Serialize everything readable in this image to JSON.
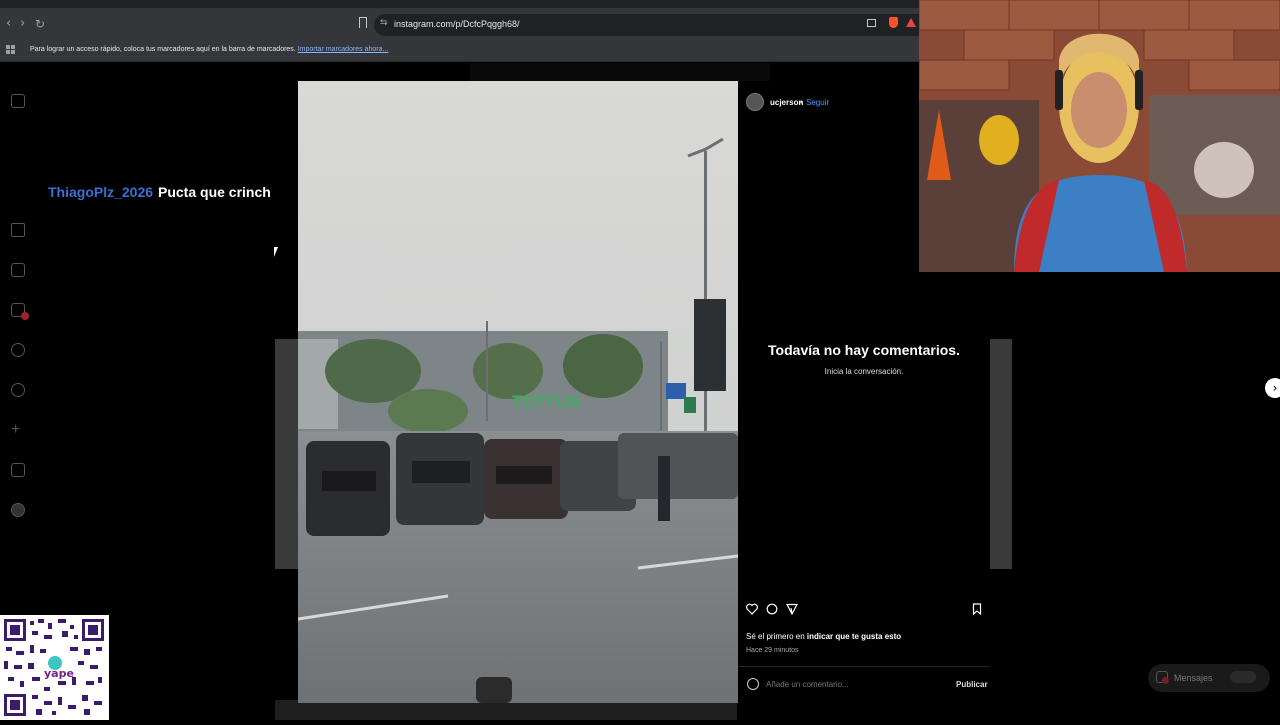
{
  "browser": {
    "url": "instagram.com/p/DcfcPqggh68/",
    "bookmarks_bar_text": "Para lograr un acceso rápido, coloca tus marcadores aquí en la barra de marcadores.",
    "bookmarks_bar_link": "Importar marcadores ahora...",
    "back_glyph": "‹",
    "forward_glyph": "›",
    "reload_glyph": "↻",
    "site_icon_glyph": "⇆"
  },
  "stream_overlay": {
    "chat_user": "ThiagoPlz_2026",
    "chat_message": "Pucta que crinch",
    "user_color": "#3b6fd4"
  },
  "sidebar": {
    "icons": [
      "instagram-logo-icon",
      "home-icon",
      "reels-icon",
      "messages-icon",
      "search-icon",
      "notifications-icon",
      "create-icon",
      "dashboard-icon",
      "profile-icon"
    ]
  },
  "post": {
    "username": "ucjerson",
    "separator": "•",
    "follow_label": "Seguir",
    "no_comments_title": "Todavía no hay comentarios.",
    "no_comments_subtitle": "Inicia la conversación.",
    "like_prefix": "Sé el primero en ",
    "like_action": "indicar que te gusta esto",
    "time_ago": "Hace 29 minutos",
    "comment_placeholder": "Añade un comentario...",
    "publish_label": "Publicar",
    "photo_sign_text": "TOTTUS",
    "accent_color": "#4a9eff"
  },
  "navigation": {
    "next_glyph": "›"
  },
  "messages": {
    "label": "Mensajes"
  },
  "qr": {
    "brand_text": "yape"
  }
}
